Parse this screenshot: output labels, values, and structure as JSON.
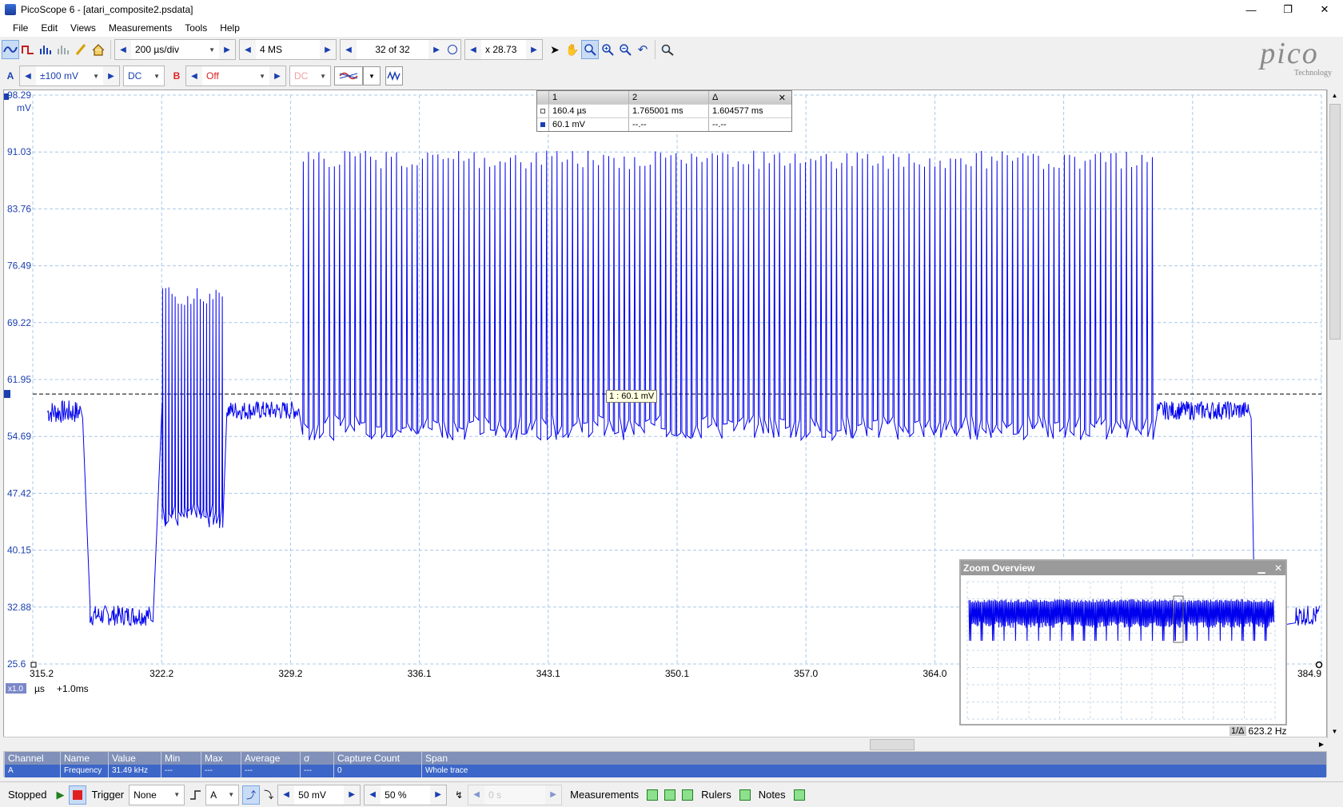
{
  "window": {
    "title": "PicoScope 6 - [atari_composite2.psdata]",
    "min_glyph": "—",
    "max_glyph": "❐",
    "close_glyph": "✕"
  },
  "menu": [
    "File",
    "Edit",
    "Views",
    "Measurements",
    "Tools",
    "Help"
  ],
  "toolbar1": {
    "timebase": "200 µs/div",
    "samples": "4 MS",
    "buffer": "32 of 32",
    "zoom": "x 28.73"
  },
  "toolbar2": {
    "channel_a": "A",
    "range_a": "±100 mV",
    "coupling_a": "DC",
    "channel_b": "B",
    "range_b": "Off",
    "coupling_b": "DC"
  },
  "logo": {
    "text": "pico",
    "sub": "Technology"
  },
  "cursor_table": {
    "headers": [
      "1",
      "2",
      "Δ"
    ],
    "rows": [
      [
        "160.4 µs",
        "1.765001 ms",
        "1.604577 ms"
      ],
      [
        "60.1 mV",
        "--.--",
        "--.--"
      ]
    ]
  },
  "cursor_tooltip": "1 : 60.1 mV",
  "chart_data": {
    "type": "line",
    "title": "",
    "xlabel": "µs",
    "ylabel": "mV",
    "x_unit": "µs",
    "x_offset_label": "+1.0ms",
    "x_scale_badge": "x1.0",
    "xlim": [
      315.2,
      384.9
    ],
    "ylim": [
      25.6,
      98.29
    ],
    "x_ticks": [
      "315.2",
      "322.2",
      "329.2",
      "336.1",
      "343.1",
      "350.1",
      "357.0",
      "364.0",
      "384.9"
    ],
    "y_ticks": [
      "98.29",
      "91.03",
      "83.76",
      "76.49",
      "69.22",
      "61.95",
      "54.69",
      "47.42",
      "40.15",
      "32.88",
      "25.6"
    ],
    "y_unit": "mV",
    "grid": true,
    "trigger_level": 60.1,
    "series": [
      {
        "color": "#0000ee",
        "segments": [
          {
            "x": [
              316.0,
              317.8
            ],
            "kind": "noise",
            "center": 57.8,
            "amp": 1.5
          },
          {
            "x": [
              317.9,
              318.3
            ],
            "kind": "fall",
            "from": 57.0,
            "to": 33.0
          },
          {
            "x": [
              318.3,
              321.6
            ],
            "kind": "noise",
            "center": 31.8,
            "amp": 1.3
          },
          {
            "x": [
              321.7,
              322.2
            ],
            "kind": "rise",
            "from": 31.0,
            "to": 59.0
          },
          {
            "x": [
              322.2,
              325.6
            ],
            "kind": "burst",
            "low": 44.5,
            "high": 73.8,
            "period": 0.17
          },
          {
            "x": [
              325.7,
              329.6
            ],
            "kind": "noise",
            "center": 58.0,
            "amp": 1.2
          },
          {
            "x": [
              329.8,
              375.9
            ],
            "kind": "burst",
            "low": 55.8,
            "high": 91.2,
            "period": 0.28
          },
          {
            "x": [
              376.0,
              381.0
            ],
            "kind": "noise",
            "center": 58.0,
            "amp": 1.2
          },
          {
            "x": [
              381.1,
              381.3
            ],
            "kind": "fall",
            "from": 57.0,
            "to": 30.0
          },
          {
            "x": [
              383.5,
              384.8
            ],
            "kind": "noise",
            "center": 31.8,
            "amp": 1.3
          }
        ]
      }
    ]
  },
  "zoom_overview": {
    "title": "Zoom Overview"
  },
  "freq_readout": "623.2 Hz",
  "freq_prefix": "1/Δ",
  "measurements": {
    "headers": [
      "Channel",
      "Name",
      "Value",
      "Min",
      "Max",
      "Average",
      "σ",
      "Capture Count",
      "Span"
    ],
    "rows": [
      [
        "A",
        "Frequency",
        "31.49 kHz",
        "---",
        "---",
        "---",
        "---",
        "0",
        "Whole trace"
      ]
    ]
  },
  "statusbar": {
    "state": "Stopped",
    "trigger_label": "Trigger",
    "trigger_mode": "None",
    "trigger_channel": "A",
    "threshold": "50 mV",
    "pretrigger": "50 %",
    "delay": "0 s",
    "measurements_label": "Measurements",
    "rulers_label": "Rulers",
    "notes_label": "Notes"
  }
}
